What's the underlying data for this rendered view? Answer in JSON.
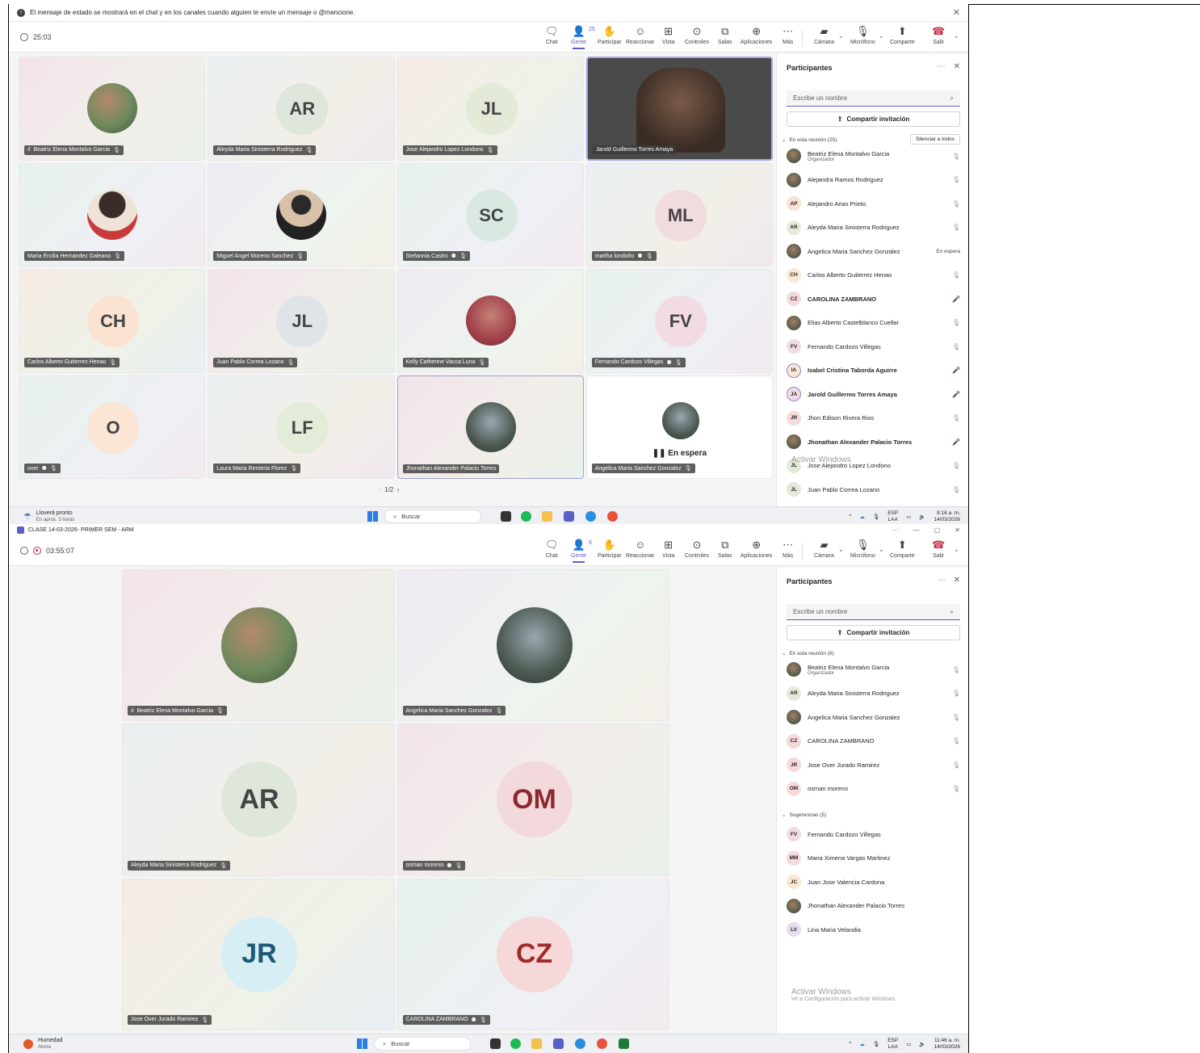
{
  "banner": {
    "icon": "info-icon",
    "text": "El mensaje de estado se mostrará en el chat y en los canales cuando alguien te envíe un mensaje o @mencione."
  },
  "toolbar_labels": {
    "chat": "Chat",
    "people": "Gente",
    "raise": "Participar",
    "react": "Reaccionar",
    "view": "Vista",
    "controls": "Controles",
    "rooms": "Salas",
    "apps": "Aplicaciones",
    "more": "Más",
    "camera": "Cámara",
    "mic": "Micrófono",
    "share": "Comparte",
    "leave": "Salir"
  },
  "meeting1": {
    "timer": "25:03",
    "people_count": "25",
    "tiles": [
      {
        "initials": "",
        "name": "Beatriz Elena Montalvo Garcia",
        "prefix": "ıl"
      },
      {
        "initials": "AR",
        "name": "Aleyda Maria Sinisterra Rodriguez"
      },
      {
        "initials": "JL",
        "name": "Jose Alejandro Lopez Londono"
      },
      {
        "initials": "",
        "name": "Jarold Guillermo Torres Amaya"
      },
      {
        "initials": "",
        "name": "Maria Ercilia Hernandez Galeano"
      },
      {
        "initials": "",
        "name": "Miguel Angel Moreno Sanchez"
      },
      {
        "initials": "SC",
        "name": "Stefannia Castro"
      },
      {
        "initials": "ML",
        "name": "martha londoño"
      },
      {
        "initials": "CH",
        "name": "Carlos Alberto Gutierrez Henao"
      },
      {
        "initials": "JL",
        "name": "Juan Pablo Correa Lozano"
      },
      {
        "initials": "",
        "name": "Kelly Catherine Vacca Luna"
      },
      {
        "initials": "FV",
        "name": "Fernando Cardozo Villegas"
      },
      {
        "initials": "O",
        "name": "over"
      },
      {
        "initials": "LF",
        "name": "Laura Maria Renteria Florez"
      },
      {
        "initials": "",
        "name": "Jhonathan Alexander Palacio Torres"
      },
      {
        "initials": "",
        "name": "Angelica Maria Sanchez Gonzalez",
        "status": "En espera"
      }
    ],
    "pager": "1/2",
    "panel": {
      "title": "Participantes",
      "search_placeholder": "Escribe un nombre",
      "share_label": "Compartir invitación",
      "section": "En esta reunión (25)",
      "mute_all": "Silenciar a todos",
      "participants": [
        {
          "initials": "",
          "name": "Beatriz Elena Montalvo Garcia",
          "sub": "Organizador",
          "state": "muted"
        },
        {
          "initials": "",
          "name": "Alejandra Ramos Rodriguez",
          "state": "muted"
        },
        {
          "initials": "AP",
          "name": "Alejandro Arias Prieto",
          "state": "muted"
        },
        {
          "initials": "AR",
          "name": "Aleyda Maria Sinisterra Rodriguez",
          "state": "muted"
        },
        {
          "initials": "",
          "name": "Angelica Maria Sanchez Gonzalez",
          "state": "En espera"
        },
        {
          "initials": "CH",
          "name": "Carlos Alberto Gutierrez Henao",
          "state": "muted"
        },
        {
          "initials": "CZ",
          "name": "CAROLINA ZAMBRANO",
          "state": "mic"
        },
        {
          "initials": "",
          "name": "Elias Alberto Castelblanco Cuellar",
          "state": "muted"
        },
        {
          "initials": "FV",
          "name": "Fernando Cardozo Villegas",
          "state": "muted"
        },
        {
          "initials": "IA",
          "name": "Isabel Cristina Taborda Aguirre",
          "state": "mic"
        },
        {
          "initials": "JA",
          "name": "Jarold Guillermo Torres Amaya",
          "state": "mic"
        },
        {
          "initials": "JR",
          "name": "Jhon Edison Rivera Rios",
          "state": "muted"
        },
        {
          "initials": "",
          "name": "Jhonathan Alexander Palacio Torres",
          "state": "mic"
        },
        {
          "initials": "JL",
          "name": "Jose Alejandro Lopez Londono",
          "state": "muted"
        },
        {
          "initials": "JL",
          "name": "Juan Pablo Correa Lozano",
          "state": "muted"
        }
      ],
      "activate": "Activar Windows"
    },
    "taskbar": {
      "weather": "Lloverá pronto",
      "weather_sub": "En aprox. 3 horas",
      "search": "Buscar",
      "lang": "ESP",
      "lang_sub": "LAA",
      "time": "8:16 a. m.",
      "date": "14/03/2026"
    }
  },
  "meeting2": {
    "window_title": "CLASE 14-03-2026- PRIMER SEM - ARM",
    "timer": "03:55:07",
    "people_count": "6",
    "tiles": [
      {
        "initials": "",
        "name": "Beatriz Elena Montalvo Garcia",
        "prefix": "ıl"
      },
      {
        "initials": "",
        "name": "Angelica Maria Sanchez Gonzalez"
      },
      {
        "initials": "AR",
        "name": "Aleyda Maria Sinisterra Rodriguez"
      },
      {
        "initials": "OM",
        "name": "osman moreno"
      },
      {
        "initials": "JR",
        "name": "Jose Over Jurado Ramirez"
      },
      {
        "initials": "CZ",
        "name": "CAROLINA ZAMBRANO"
      }
    ],
    "panel": {
      "title": "Participantes",
      "search_placeholder": "Escribe un nombre",
      "share_label": "Compartir invitación",
      "section": "En esta reunión (6)",
      "participants": [
        {
          "initials": "",
          "name": "Beatriz Elena Montalvo Garcia",
          "sub": "Organizador",
          "state": "muted"
        },
        {
          "initials": "AR",
          "name": "Aleyda Maria Sinisterra Rodriguez",
          "state": "muted"
        },
        {
          "initials": "",
          "name": "Angelica Maria Sanchez Gonzalez",
          "state": "muted"
        },
        {
          "initials": "CZ",
          "name": "CAROLINA ZAMBRANO",
          "state": "muted"
        },
        {
          "initials": "JR",
          "name": "Jose Over Jurado Ramirez",
          "state": "muted"
        },
        {
          "initials": "OM",
          "name": "osman moreno",
          "state": "muted"
        }
      ],
      "suggest_section": "Sugerencias (5)",
      "suggestions": [
        {
          "initials": "FV",
          "name": "Fernando Cardozo Villegas"
        },
        {
          "initials": "MM",
          "name": "Maria Ximena Vargas Martinez"
        },
        {
          "initials": "JC",
          "name": "Juan Jose Valencia Cardona"
        },
        {
          "initials": "",
          "name": "Jhonathan Alexander Palacio Torres"
        },
        {
          "initials": "LV",
          "name": "Lina Maria Velandia"
        }
      ],
      "activate": "Activar Windows",
      "activate_sub": "Ve a Configuración para activar Windows."
    },
    "taskbar": {
      "weather": "Humedad",
      "weather_sub": "Ahora",
      "search": "Buscar",
      "lang": "ESP",
      "lang_sub": "LAA",
      "time": "11:46 a. m.",
      "date": "14/03/2026"
    }
  }
}
